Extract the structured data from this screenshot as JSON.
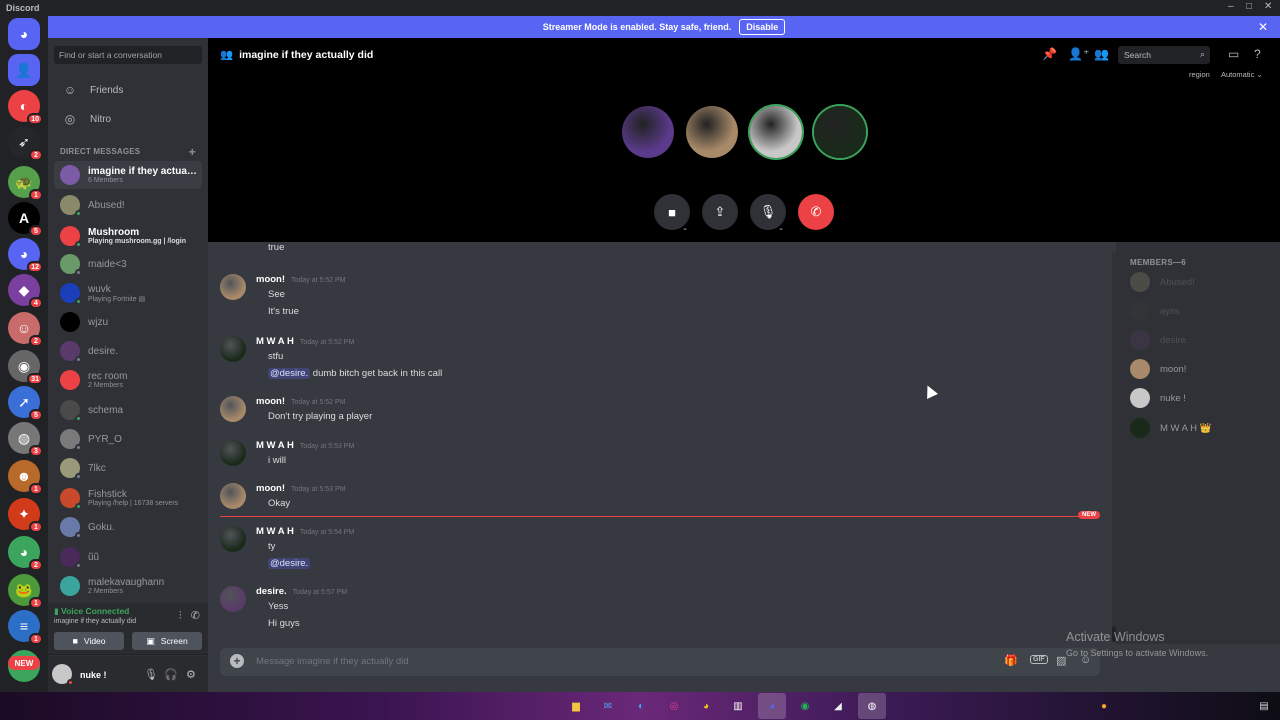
{
  "window": {
    "app_name": "Discord",
    "min": "–",
    "max": "□",
    "close": "✕"
  },
  "banner": {
    "text": "Streamer Mode is enabled. Stay safe, friend.",
    "button": "Disable",
    "close": "✕"
  },
  "guilds": [
    {
      "icon": "discord-home-icon",
      "color": "#5865f2",
      "glyph": "◕",
      "badge": ""
    },
    {
      "icon": "friends-icon",
      "color": "#5865f2",
      "glyph": "👤",
      "badge": ""
    },
    {
      "icon": "server-icon",
      "color": "#ed4245",
      "glyph": "◐",
      "badge": "10"
    },
    {
      "icon": "server-icon",
      "color": "#23272a",
      "glyph": "➶",
      "badge": "2"
    },
    {
      "icon": "server-icon",
      "color": "#57a04b",
      "glyph": "🐢",
      "badge": "1"
    },
    {
      "icon": "server-icon",
      "color": "#000000",
      "glyph": "A",
      "badge": "5"
    },
    {
      "icon": "server-icon",
      "color": "#5865f2",
      "glyph": "◕",
      "badge": "12"
    },
    {
      "icon": "server-icon",
      "color": "#7b3fa0",
      "glyph": "◆",
      "badge": "4"
    },
    {
      "icon": "server-icon",
      "color": "#c76b6b",
      "glyph": "☺",
      "badge": "2"
    },
    {
      "icon": "server-icon",
      "color": "#666666",
      "glyph": "◉",
      "badge": "31"
    },
    {
      "icon": "server-icon",
      "color": "#3a6fd8",
      "glyph": "➚",
      "badge": "5"
    },
    {
      "icon": "server-icon",
      "color": "#777777",
      "glyph": "◍",
      "badge": "3"
    },
    {
      "icon": "server-icon",
      "color": "#b86a2a",
      "glyph": "☻",
      "badge": "1"
    },
    {
      "icon": "server-icon",
      "color": "#d13b1a",
      "glyph": "✦",
      "badge": "1"
    },
    {
      "icon": "server-icon",
      "color": "#3ba55d",
      "glyph": "◕",
      "badge": "2"
    },
    {
      "icon": "server-icon",
      "color": "#4c9a3c",
      "glyph": "🐸",
      "badge": "1"
    },
    {
      "icon": "server-icon",
      "color": "#2b6fc6",
      "glyph": "≡",
      "badge": "1"
    },
    {
      "icon": "server-icon",
      "color": "#3ba55d",
      "glyph": "◕",
      "badge": ""
    }
  ],
  "new_pill": "NEW",
  "dm_sidebar": {
    "search_placeholder": "Find or start a conversation",
    "nav": [
      {
        "icon": "friends-icon",
        "glyph": "☺",
        "label": "Friends"
      },
      {
        "icon": "nitro-icon",
        "glyph": "◎",
        "label": "Nitro"
      }
    ],
    "header": "DIRECT MESSAGES",
    "add": "+",
    "dms": [
      {
        "name": "imagine if they actually did",
        "sub": "6 Members",
        "color": "#7b5aa6",
        "status": "",
        "active": true,
        "bright": false
      },
      {
        "name": "Abused!",
        "sub": "",
        "color": "#8a8a6a",
        "status": "#3ba55d",
        "active": false,
        "bright": false
      },
      {
        "name": "Mushroom",
        "sub": "Playing mushroom.gg | /login",
        "color": "#ed4245",
        "status": "#3ba55d",
        "active": false,
        "bright": true
      },
      {
        "name": "maide<3",
        "sub": "",
        "color": "#6a9a6a",
        "status": "#747f8d",
        "active": false,
        "bright": false
      },
      {
        "name": "wuvk",
        "sub": "Playing Fortnite ▤",
        "color": "#1a3fb8",
        "status": "#3ba55d",
        "active": false,
        "bright": false
      },
      {
        "name": "wjzu",
        "sub": "",
        "color": "#000000",
        "status": "",
        "active": false,
        "bright": false
      },
      {
        "name": "desire.",
        "sub": "",
        "color": "#5a3a6a",
        "status": "#747f8d",
        "active": false,
        "bright": false
      },
      {
        "name": "rec room",
        "sub": "2 Members",
        "color": "#ed4245",
        "status": "",
        "active": false,
        "bright": false
      },
      {
        "name": "schema",
        "sub": "",
        "color": "#4a4a4a",
        "status": "#3ba55d",
        "active": false,
        "bright": false
      },
      {
        "name": "PYR_O",
        "sub": "",
        "color": "#7a7a7a",
        "status": "#747f8d",
        "active": false,
        "bright": false
      },
      {
        "name": "7lkc",
        "sub": "",
        "color": "#9a9a7a",
        "status": "#747f8d",
        "active": false,
        "bright": false
      },
      {
        "name": "Fishstick",
        "sub": "Playing /help | 16738 servers",
        "color": "#c84a2a",
        "status": "#3ba55d",
        "active": false,
        "bright": false
      },
      {
        "name": "Goku.",
        "sub": "",
        "color": "#6a7aa8",
        "status": "#747f8d",
        "active": false,
        "bright": false
      },
      {
        "name": "ũũ",
        "sub": "",
        "color": "#4a2a5a",
        "status": "#747f8d",
        "active": false,
        "bright": false
      },
      {
        "name": "malekavaughann",
        "sub": "2 Members",
        "color": "#3ba59d",
        "status": "",
        "active": false,
        "bright": false
      }
    ]
  },
  "voice_panel": {
    "status": "Voice Connected",
    "channel": "imagine if they actually did",
    "video": "Video",
    "screen": "Screen"
  },
  "user_panel": {
    "name": "nuke !"
  },
  "chat": {
    "channel_title": "imagine if they actually did",
    "search_placeholder": "Search",
    "region_label": "region",
    "region_value": "Automatic ⌄",
    "participants": [
      {
        "color": "#5a3a8a",
        "speaking": false
      },
      {
        "color": "#a88a6a",
        "speaking": false
      },
      {
        "color": "#c8c8c8",
        "speaking": true
      },
      {
        "color": "#1a2a1a",
        "speaking": true
      }
    ],
    "messages": [
      {
        "author": "",
        "time": "",
        "lines": [
          "true"
        ],
        "avatar": "#3a3a3a"
      },
      {
        "author": "moon!",
        "time": "Today at 5:52 PM",
        "lines": [
          "See",
          "It's true"
        ],
        "avatar": "#a88a6a"
      },
      {
        "author": "M W A H",
        "time": "Today at 5:52 PM",
        "lines": [
          "stfu",
          "@desire. dumb bitch get back in this call"
        ],
        "avatar": "#1a2a1a"
      },
      {
        "author": "moon!",
        "time": "Today at 5:52 PM",
        "lines": [
          "Don't try playing a player"
        ],
        "avatar": "#a88a6a"
      },
      {
        "author": "M W A H",
        "time": "Today at 5:53 PM",
        "lines": [
          "i will"
        ],
        "avatar": "#1a2a1a"
      },
      {
        "author": "moon!",
        "time": "Today at 5:53 PM",
        "lines": [
          "Okay"
        ],
        "avatar": "#a88a6a"
      },
      {
        "author": "M W A H",
        "time": "Today at 5:54 PM",
        "lines": [
          "ty",
          "@desire."
        ],
        "avatar": "#1a2a1a"
      },
      {
        "author": "desire.",
        "time": "Today at 5:57 PM",
        "lines": [
          "Yess",
          "Hi guys"
        ],
        "avatar": "#5a3a6a"
      }
    ],
    "mention": "@desire.",
    "mention_rest": " dumb bitch get back in this call",
    "new_tag": "NEW",
    "composer_placeholder": "Message imagine if they actually did",
    "gif": "GIF"
  },
  "members": {
    "header": "MEMBERS—6",
    "list": [
      {
        "name": "Abused!",
        "color": "#8a8a6a",
        "offline": true
      },
      {
        "name": "ayss",
        "color": "#3a3a3a",
        "offline": true
      },
      {
        "name": "desire.",
        "color": "#5a3a6a",
        "offline": true
      },
      {
        "name": "moon!",
        "color": "#a88a6a",
        "offline": false
      },
      {
        "name": "nuke !",
        "color": "#c8c8c8",
        "offline": false
      },
      {
        "name": "M W A H 👑",
        "color": "#1a2a1a",
        "offline": false
      }
    ]
  },
  "watermark": {
    "title": "Activate Windows",
    "sub": "Go to Settings to activate Windows."
  }
}
